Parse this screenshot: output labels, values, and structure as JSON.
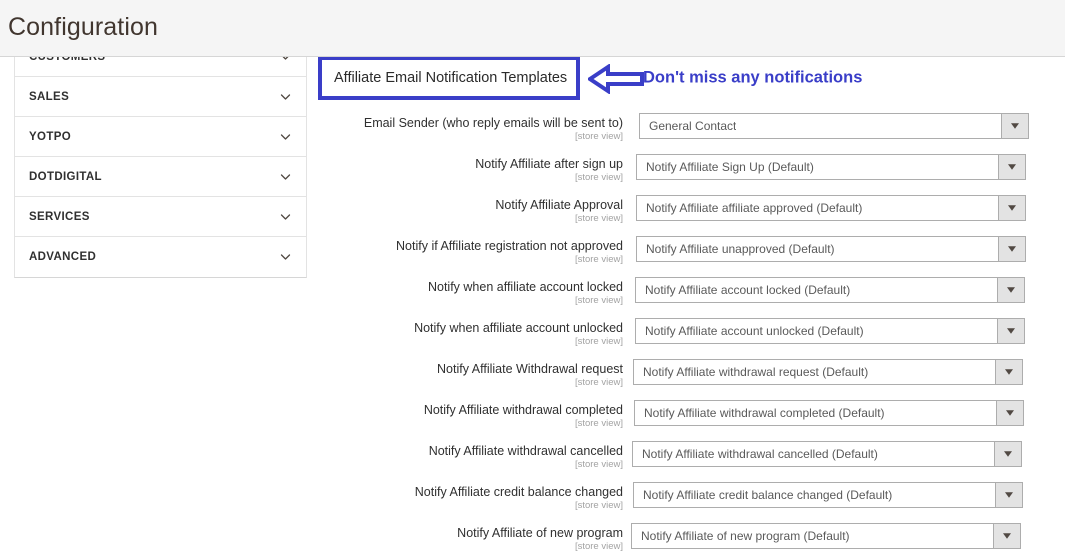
{
  "header": {
    "title": "Configuration"
  },
  "sidebar": {
    "items": [
      {
        "label": "CUSTOMERS",
        "icon": "chevron-down-icon"
      },
      {
        "label": "SALES",
        "icon": "chevron-down-icon"
      },
      {
        "label": "YOTPO",
        "icon": "chevron-down-icon"
      },
      {
        "label": "DOTDIGITAL",
        "icon": "chevron-down-icon"
      },
      {
        "label": "SERVICES",
        "icon": "chevron-down-icon"
      },
      {
        "label": "ADVANCED",
        "icon": "chevron-down-icon"
      }
    ]
  },
  "section": {
    "title": "Affiliate Email Notification Templates",
    "annotation_text": "Don't miss any notifications",
    "annotation_icon": "arrow-left-icon",
    "highlight_color": "#3a3ec8",
    "annotation_color": "#3a3ec8"
  },
  "form": {
    "scope_label": "[store view]",
    "rows": [
      {
        "label": "Email Sender (who reply emails will be sent to)",
        "scope": "[store view]",
        "value": "General Contact",
        "offset": 8
      },
      {
        "label": "Notify Affiliate after sign up",
        "scope": "[store view]",
        "value": "Notify Affiliate Sign Up (Default)",
        "offset": 5
      },
      {
        "label": "Notify Affiliate Approval",
        "scope": "[store view]",
        "value": "Notify Affiliate affiliate approved (Default)",
        "offset": 5
      },
      {
        "label": "Notify if Affiliate registration not approved",
        "scope": "[store view]",
        "value": "Notify Affiliate unapproved (Default)",
        "offset": 5
      },
      {
        "label": "Notify when affiliate account locked",
        "scope": "[store view]",
        "value": "Notify Affiliate account locked (Default)",
        "offset": 4
      },
      {
        "label": "Notify when affiliate account unlocked",
        "scope": "[store view]",
        "value": "Notify Affiliate account unlocked (Default)",
        "offset": 4
      },
      {
        "label": "Notify Affiliate Withdrawal request",
        "scope": "[store view]",
        "value": "Notify Affiliate withdrawal request (Default)",
        "offset": 2
      },
      {
        "label": "Notify Affiliate withdrawal completed",
        "scope": "[store view]",
        "value": "Notify Affiliate withdrawal completed (Default)",
        "offset": 3
      },
      {
        "label": "Notify Affiliate withdrawal cancelled",
        "scope": "[store view]",
        "value": "Notify Affiliate withdrawal cancelled (Default)",
        "offset": 1
      },
      {
        "label": "Notify Affiliate credit balance changed",
        "scope": "[store view]",
        "value": "Notify Affiliate credit balance changed (Default)",
        "offset": 2
      },
      {
        "label": "Notify Affiliate of new program",
        "scope": "[store view]",
        "value": "Notify Affiliate of new program (Default)",
        "offset": 0
      }
    ]
  }
}
